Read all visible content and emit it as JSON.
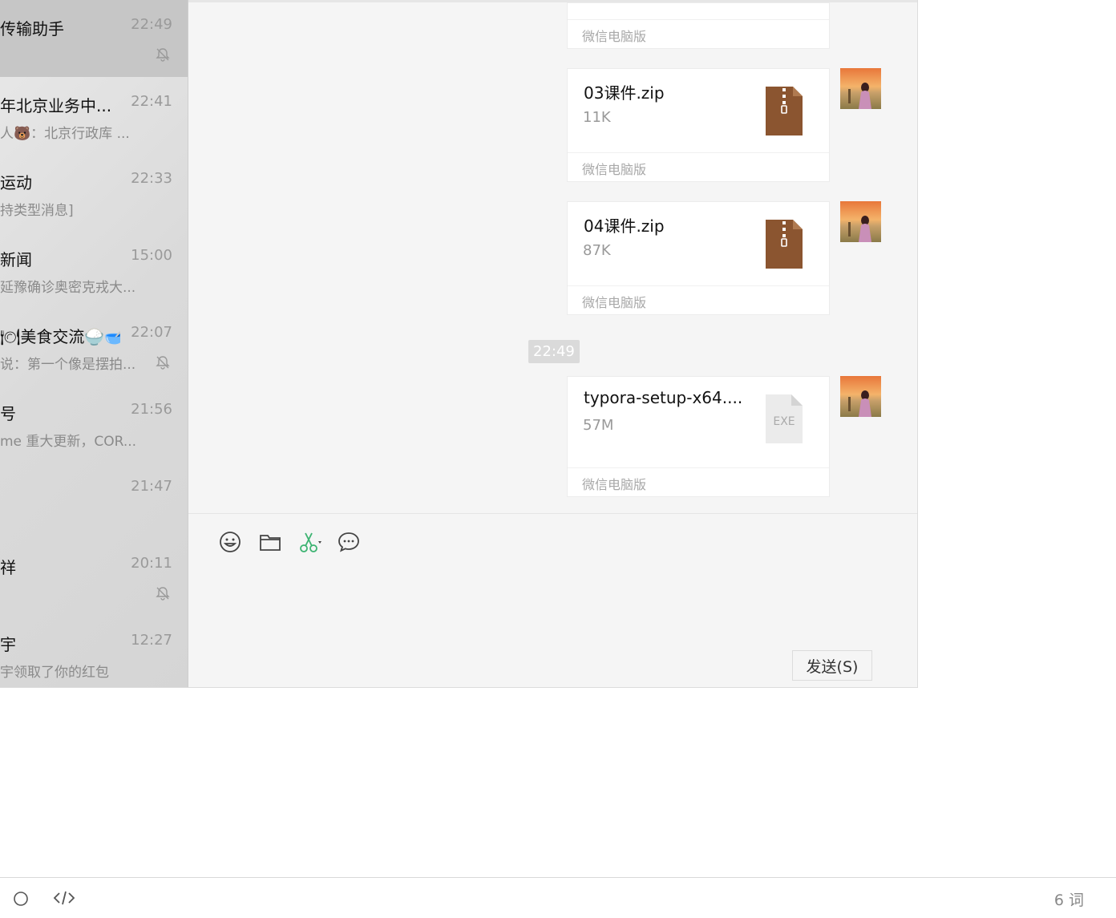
{
  "sidebar": {
    "conversations": [
      {
        "name": "传输助手",
        "time": "22:49",
        "preview": "",
        "muted": true,
        "active": true
      },
      {
        "name": "年北京业务中...",
        "time": "22:41",
        "preview": "人🐻：北京行政库 ...",
        "muted": false
      },
      {
        "name": "运动",
        "time": "22:33",
        "preview": "持类型消息]",
        "muted": false
      },
      {
        "name": "新闻",
        "time": "15:00",
        "preview": "延豫确诊奥密克戎大...",
        "muted": false
      },
      {
        "name": "🍽美食交流🍚🥣",
        "time": "22:07",
        "preview": "说：第一个像是摆拍...",
        "muted": true
      },
      {
        "name": "号",
        "time": "21:56",
        "preview": "me 重大更新，COR...",
        "muted": false
      },
      {
        "name": "",
        "time": "21:47",
        "preview": "",
        "muted": false
      },
      {
        "name": "祥",
        "time": "20:11",
        "preview": "",
        "muted": true
      },
      {
        "name": "宇",
        "time": "12:27",
        "preview": "宇领取了你的红包",
        "muted": false
      }
    ]
  },
  "chat": {
    "messages": [
      {
        "file_name": "",
        "size": "",
        "source": "微信电脑版",
        "type": "zip"
      },
      {
        "file_name": "03课件.zip",
        "size": "11K",
        "source": "微信电脑版",
        "type": "zip"
      },
      {
        "file_name": "04课件.zip",
        "size": "87K",
        "source": "微信电脑版",
        "type": "zip"
      },
      {
        "file_name": "typora-setup-x64....",
        "size": "57M",
        "source": "微信电脑版",
        "type": "exe"
      }
    ],
    "timestamp": "22:49",
    "exe_label": "EXE"
  },
  "input": {
    "tools": [
      "emoji-icon",
      "folder-icon",
      "scissors-icon",
      "chat-bubble-icon"
    ],
    "send_label": "发送(S)"
  },
  "statusbar": {
    "word_count": "6 词"
  },
  "colors": {
    "zip_brown": "#8B5530",
    "scissors_green": "#3cb371",
    "sidebar_active": "#c6c6c6"
  }
}
